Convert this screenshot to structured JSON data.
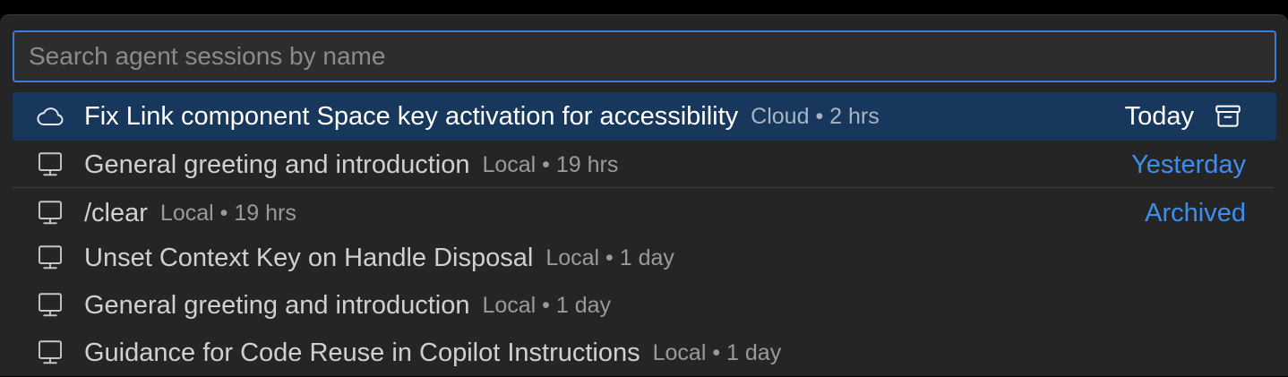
{
  "search": {
    "placeholder": "Search agent sessions by name",
    "value": ""
  },
  "sessions": [
    {
      "title": "Fix Link component Space key activation for accessibility",
      "meta": "Cloud • 2 hrs",
      "icon": "cloud-icon",
      "group": "Today",
      "selected": true,
      "action_icon": "archive-icon"
    },
    {
      "title": "General greeting and introduction",
      "meta": "Local • 19 hrs",
      "icon": "monitor-icon",
      "group": "Yesterday"
    },
    {
      "title": "/clear",
      "meta": "Local • 19 hrs",
      "icon": "monitor-icon",
      "group": "Archived"
    },
    {
      "title": "Unset Context Key on Handle Disposal",
      "meta": "Local • 1 day",
      "icon": "monitor-icon"
    },
    {
      "title": "General greeting and introduction",
      "meta": "Local • 1 day",
      "icon": "monitor-icon"
    },
    {
      "title": "Guidance for Code Reuse in Copilot Instructions",
      "meta": "Local • 1 day",
      "icon": "monitor-icon"
    }
  ],
  "colors": {
    "accent": "#3e8ef0",
    "selection": "#17375c",
    "background": "#252526",
    "focus_border": "#3e7bd4"
  }
}
